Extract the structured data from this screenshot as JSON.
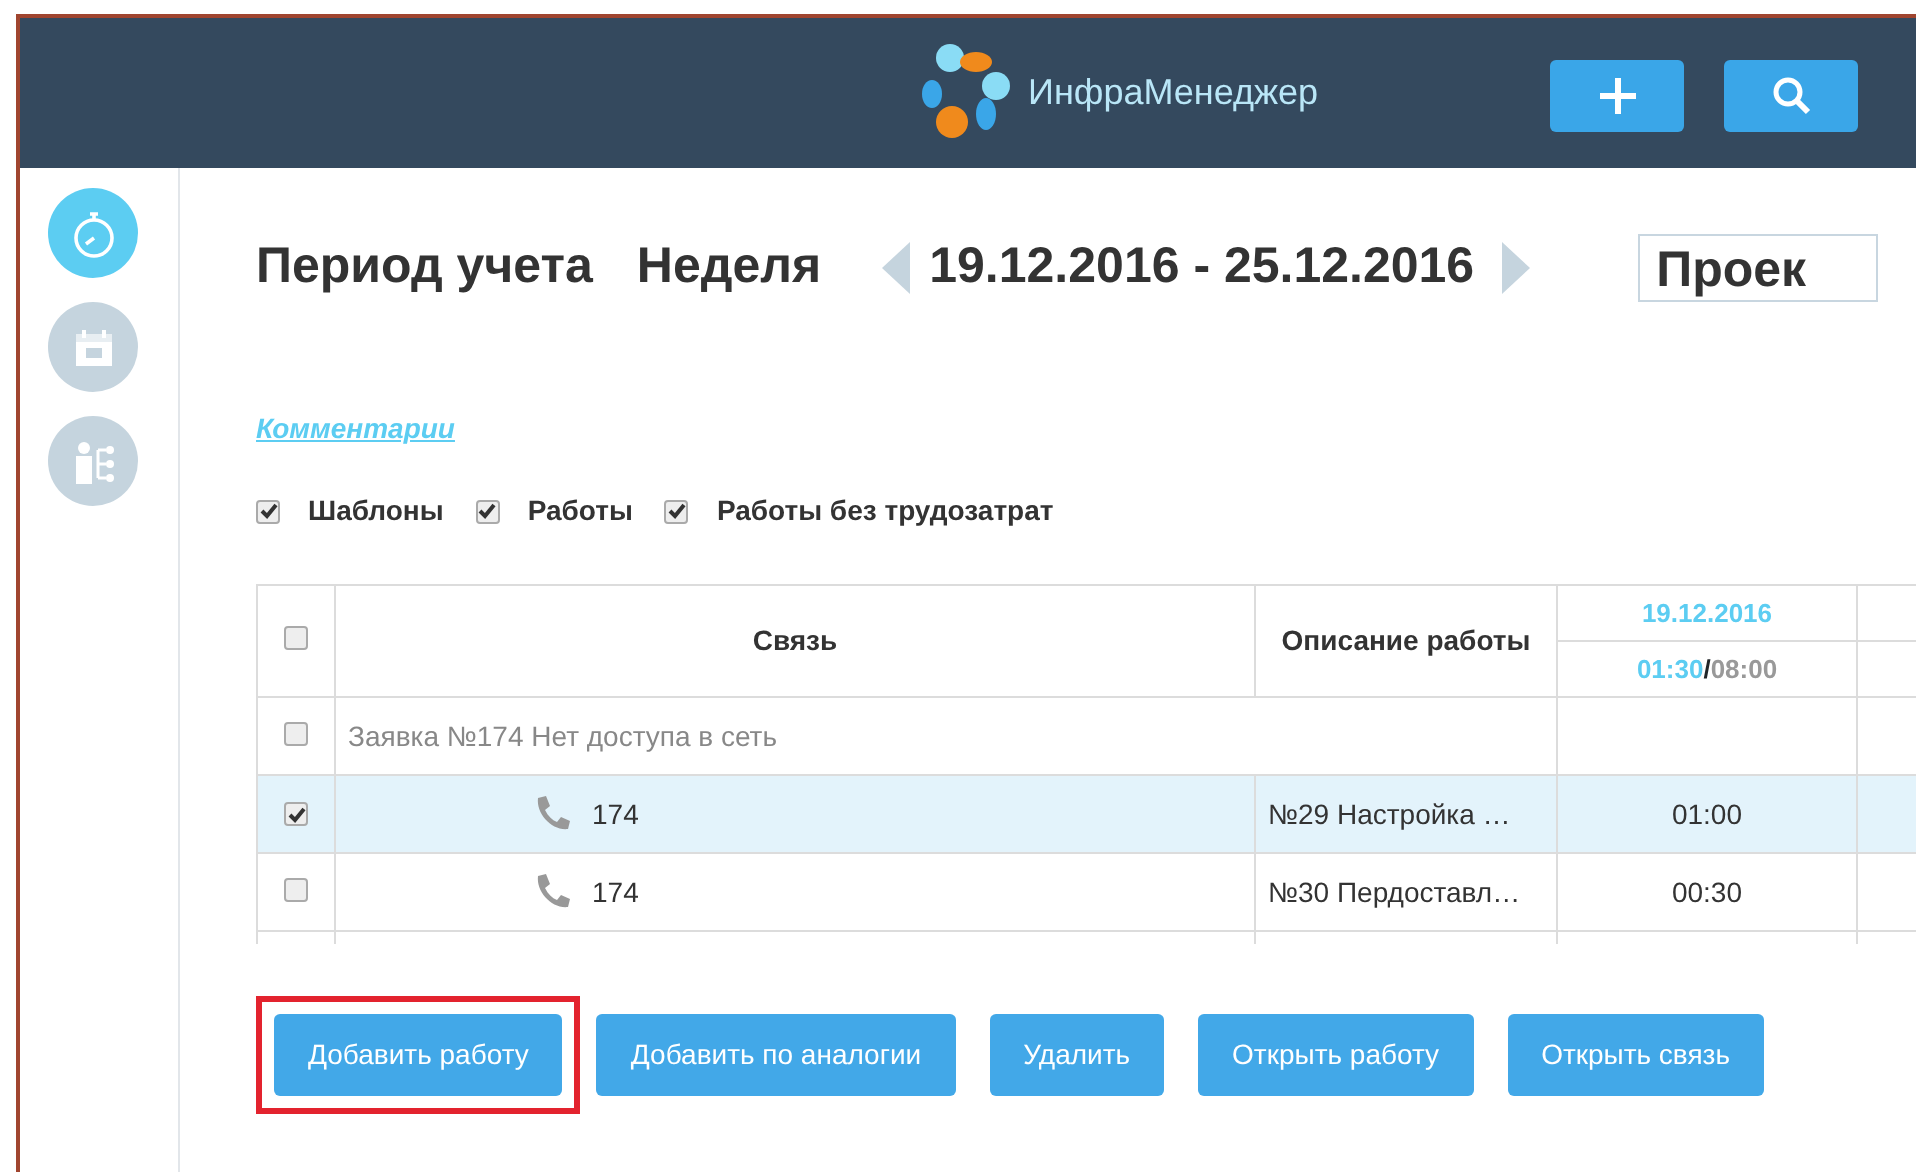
{
  "header": {
    "app_name": "ИнфраМенеджер",
    "buttons": [
      {
        "kind": "add"
      },
      {
        "kind": "search"
      }
    ]
  },
  "sidebar": {
    "items": [
      {
        "kind": "stopwatch",
        "selected": true
      },
      {
        "kind": "calendar",
        "selected": false
      },
      {
        "kind": "org",
        "selected": false
      }
    ]
  },
  "period": {
    "label": "Период учета",
    "mode": "Неделя",
    "range": "19.12.2016 - 25.12.2016",
    "project": "Проек"
  },
  "comments_link": "Комментарии",
  "filters": [
    {
      "label": "Шаблоны",
      "checked": true
    },
    {
      "label": "Работы",
      "checked": true
    },
    {
      "label": "Работы без трудозатрат",
      "checked": true
    }
  ],
  "table": {
    "select_all": false,
    "columns": [
      "Связь",
      "Описание работы"
    ],
    "day": {
      "date": "19.12.2016",
      "spent": "01:30",
      "separator": "/",
      "norm": "08:00"
    },
    "rows": [
      {
        "kind": "group",
        "checked": false,
        "selected": false,
        "title": "Заявка №174 Нет доступа в сеть"
      },
      {
        "kind": "work",
        "checked": true,
        "selected": true,
        "link": "174",
        "description": "№29 Настройка …",
        "hours": "01:00"
      },
      {
        "kind": "work",
        "checked": false,
        "selected": false,
        "link": "174",
        "description": "№30 Пердоставл…",
        "hours": "00:30"
      }
    ]
  },
  "actions": [
    {
      "label": "Добавить работу",
      "highlighted": true
    },
    {
      "label": "Добавить по аналогии",
      "highlighted": false
    },
    {
      "label": "Удалить",
      "highlighted": false
    },
    {
      "label": "Открыть работу",
      "highlighted": false
    },
    {
      "label": "Открыть связь",
      "highlighted": false
    }
  ]
}
